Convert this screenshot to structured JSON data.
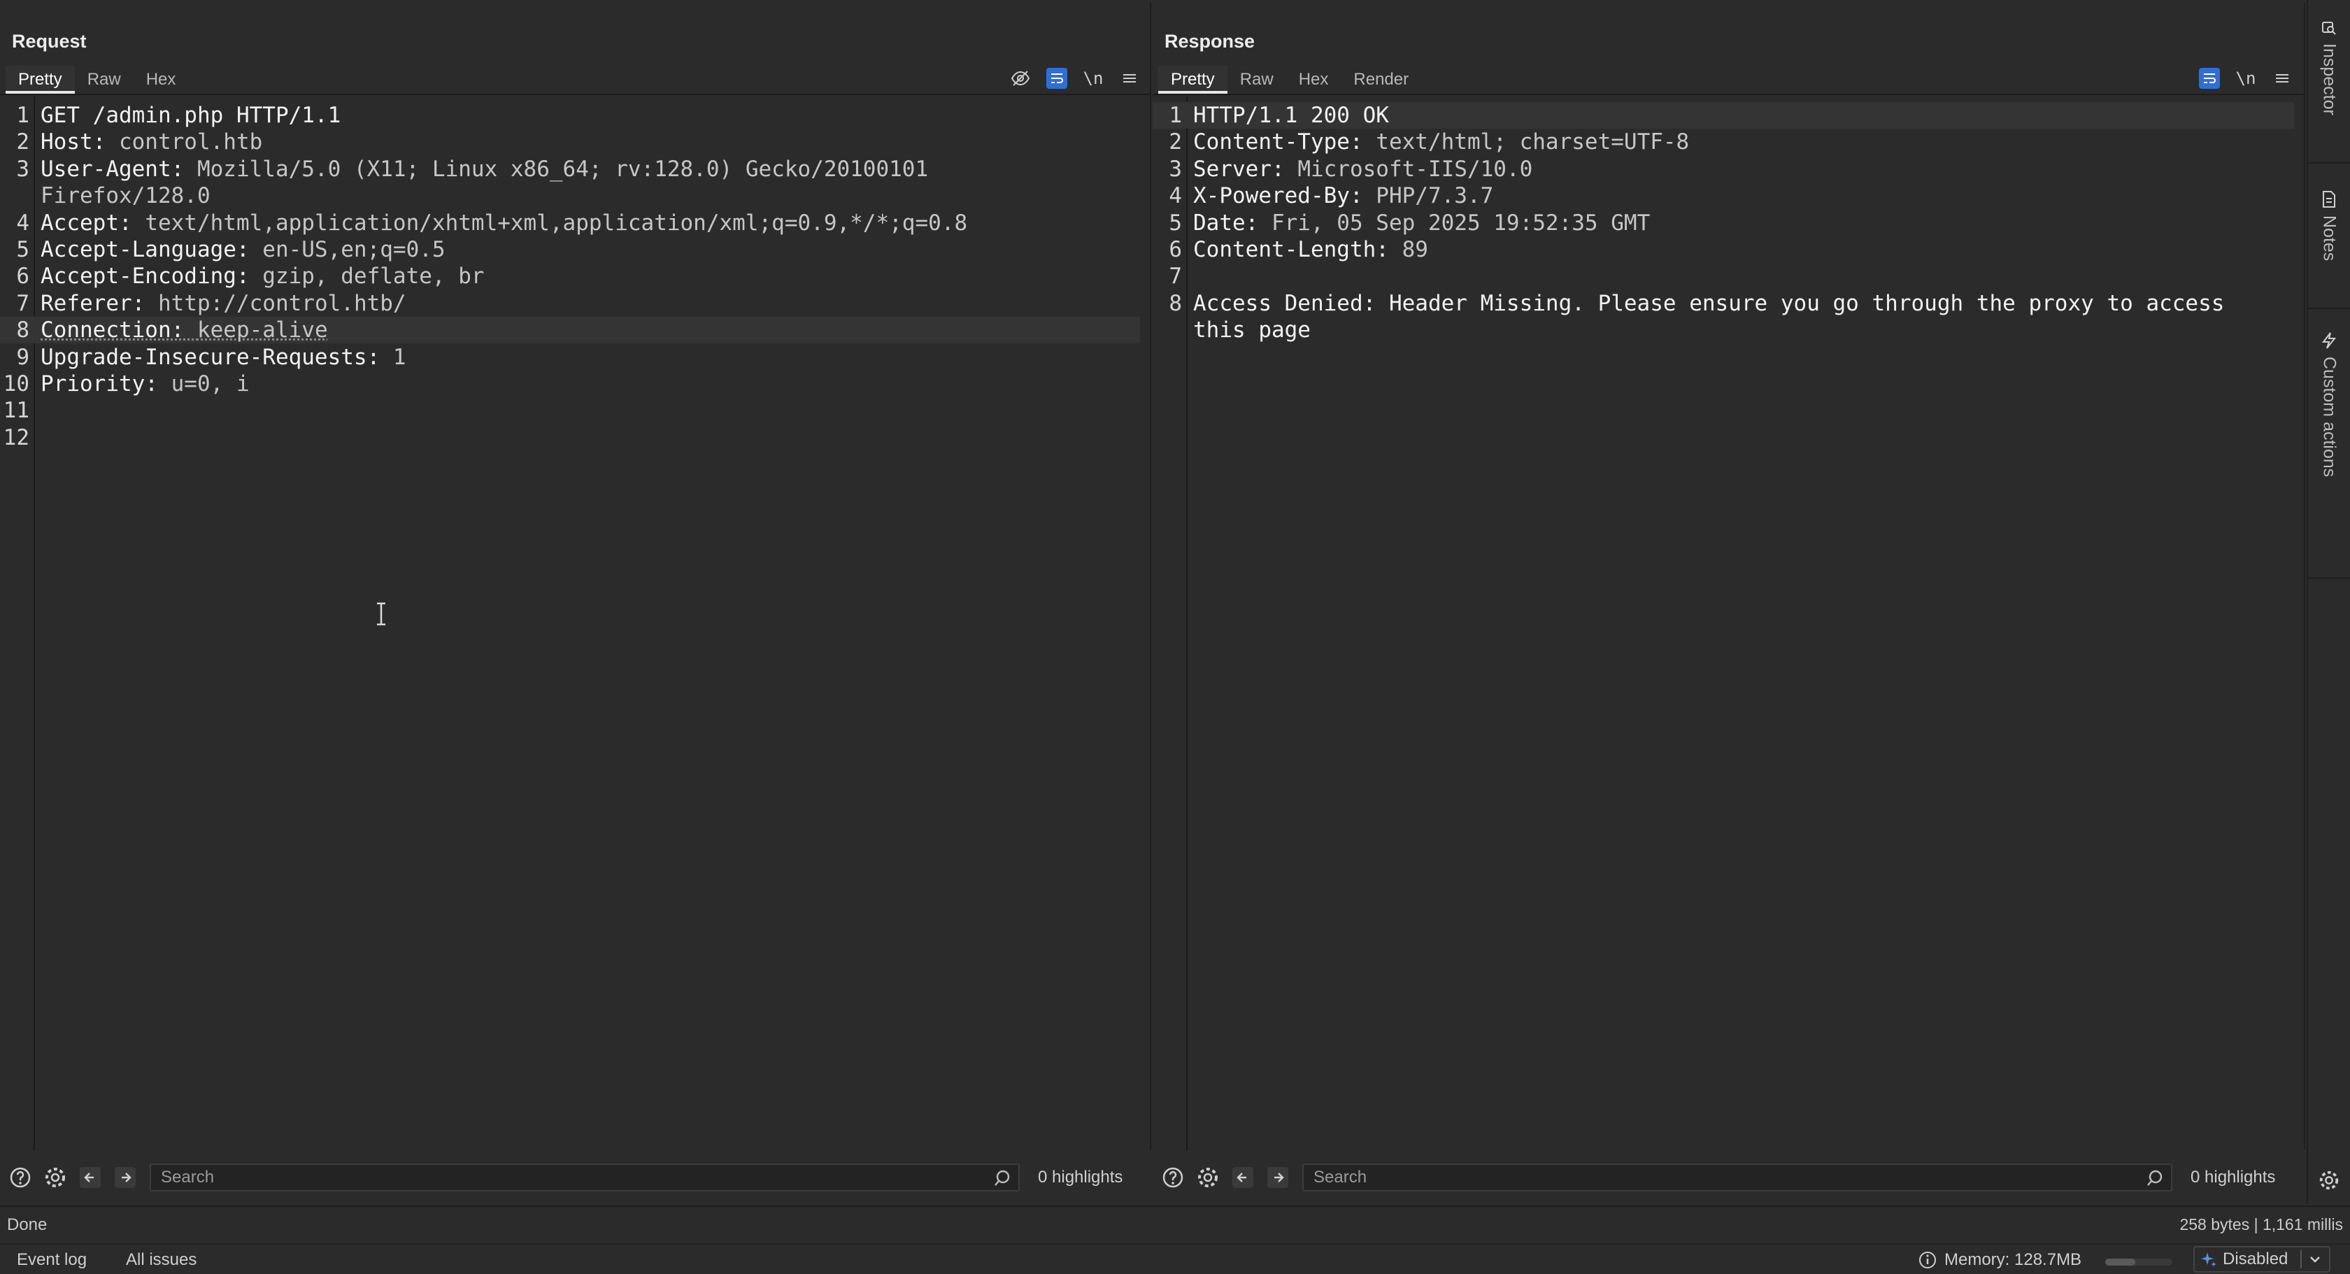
{
  "request": {
    "title": "Request",
    "tabs": [
      {
        "label": "Pretty"
      },
      {
        "label": "Raw"
      },
      {
        "label": "Hex"
      }
    ],
    "lines": [
      {
        "n": "1",
        "name": "GET /admin.php HTTP/1.1",
        "sep": "",
        "value": ""
      },
      {
        "n": "2",
        "name": "Host",
        "sep": ": ",
        "value": "control.htb"
      },
      {
        "n": "3",
        "name": "User-Agent",
        "sep": ": ",
        "value": "Mozilla/5.0 (X11; Linux x86_64; rv:128.0) Gecko/20100101"
      },
      {
        "n": "",
        "name": "",
        "sep": "",
        "value": "Firefox/128.0"
      },
      {
        "n": "4",
        "name": "Accept",
        "sep": ": ",
        "value": "text/html,application/xhtml+xml,application/xml;q=0.9,*/*;q=0.8"
      },
      {
        "n": "5",
        "name": "Accept-Language",
        "sep": ": ",
        "value": "en-US,en;q=0.5"
      },
      {
        "n": "6",
        "name": "Accept-Encoding",
        "sep": ": ",
        "value": "gzip, deflate, br"
      },
      {
        "n": "7",
        "name": "Referer",
        "sep": ": ",
        "value": "http://control.htb/"
      },
      {
        "n": "8",
        "name": "Connection",
        "sep": ": ",
        "value": "keep-alive"
      },
      {
        "n": "9",
        "name": "Upgrade-Insecure-Requests",
        "sep": ": ",
        "value": "1"
      },
      {
        "n": "10",
        "name": "Priority",
        "sep": ": ",
        "value": "u=0, i"
      },
      {
        "n": "11",
        "name": "",
        "sep": "",
        "value": ""
      },
      {
        "n": "12",
        "name": "",
        "sep": "",
        "value": ""
      }
    ],
    "search_placeholder": "Search",
    "highlights": "0 highlights"
  },
  "response": {
    "title": "Response",
    "tabs": [
      {
        "label": "Pretty"
      },
      {
        "label": "Raw"
      },
      {
        "label": "Hex"
      },
      {
        "label": "Render"
      }
    ],
    "lines": [
      {
        "n": "1",
        "name": "HTTP/1.1 200 OK",
        "sep": "",
        "value": ""
      },
      {
        "n": "2",
        "name": "Content-Type",
        "sep": ": ",
        "value": "text/html; charset=UTF-8"
      },
      {
        "n": "3",
        "name": "Server",
        "sep": ": ",
        "value": "Microsoft-IIS/10.0"
      },
      {
        "n": "4",
        "name": "X-Powered-By",
        "sep": ": ",
        "value": "PHP/7.3.7"
      },
      {
        "n": "5",
        "name": "Date",
        "sep": ": ",
        "value": "Fri, 05 Sep 2025 19:52:35 GMT"
      },
      {
        "n": "6",
        "name": "Content-Length",
        "sep": ": ",
        "value": "89"
      },
      {
        "n": "7",
        "name": "",
        "sep": "",
        "value": ""
      },
      {
        "n": "8",
        "name": "Access Denied: Header Missing. Please ensure you go through the proxy to access",
        "sep": "",
        "value": ""
      },
      {
        "n": "",
        "name": "this page",
        "sep": "",
        "value": ""
      }
    ],
    "search_placeholder": "Search",
    "highlights": "0 highlights"
  },
  "status": {
    "left": "Done",
    "right": "258 bytes | 1,161 millis"
  },
  "bottom": {
    "event_log": "Event log",
    "all_issues": "All issues",
    "memory": "Memory: 128.7MB",
    "memory_level": 0.45,
    "ai_state": "Disabled"
  },
  "sidebar": {
    "items": [
      {
        "label": "Inspector"
      },
      {
        "label": "Notes"
      },
      {
        "label": "Custom actions"
      }
    ]
  },
  "colors": {
    "accent": "#2e6fd6",
    "background": "#2b2b2b"
  }
}
